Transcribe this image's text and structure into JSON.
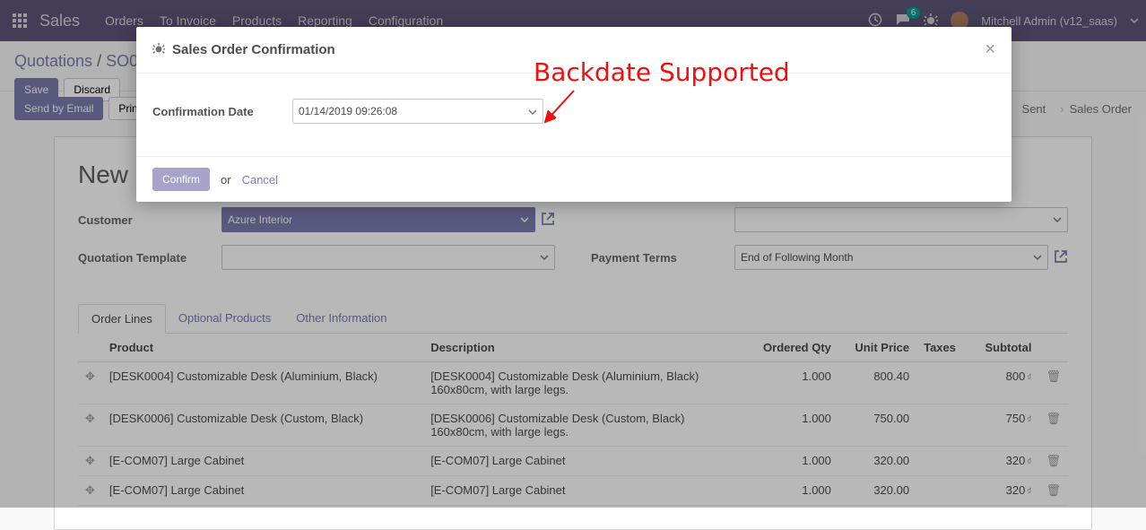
{
  "nav": {
    "brand": "Sales",
    "menu": [
      "Orders",
      "To Invoice",
      "Products",
      "Reporting",
      "Configuration"
    ],
    "chat_count": "6",
    "user": "Mitchell Admin (v12_saas)"
  },
  "breadcrumb": {
    "root": "Quotations",
    "sep": "/",
    "current": "SO0"
  },
  "buttons": {
    "save": "Save",
    "discard": "Discard",
    "send_email": "Send by Email",
    "print": "Prin"
  },
  "statusbar": {
    "stage_sent": "Sent",
    "stage_so": "Sales Order"
  },
  "record": {
    "title": "New"
  },
  "form": {
    "customer_label": "Customer",
    "customer_value": "Azure Interior",
    "quotation_tmpl_label": "Quotation Template",
    "payment_terms_label": "Payment Terms",
    "payment_terms_value": "End of Following Month"
  },
  "tabs": {
    "t1": "Order Lines",
    "t2": "Optional Products",
    "t3": "Other Information"
  },
  "table": {
    "h_product": "Product",
    "h_desc": "Description",
    "h_qty": "Ordered Qty",
    "h_price": "Unit Price",
    "h_taxes": "Taxes",
    "h_subtotal": "Subtotal",
    "rows": [
      {
        "product": "[DESK0004] Customizable Desk (Aluminium, Black)",
        "desc": "[DESK0004] Customizable Desk (Aluminium, Black)\n160x80cm, with large legs.",
        "qty": "1.000",
        "price": "800.40",
        "subtotal": "800",
        "currency": "₫"
      },
      {
        "product": "[DESK0006] Customizable Desk (Custom, Black)",
        "desc": "[DESK0006] Customizable Desk (Custom, Black)\n160x80cm, with large legs.",
        "qty": "1.000",
        "price": "750.00",
        "subtotal": "750",
        "currency": "₫"
      },
      {
        "product": "[E-COM07] Large Cabinet",
        "desc": "[E-COM07] Large Cabinet",
        "qty": "1.000",
        "price": "320.00",
        "subtotal": "320",
        "currency": "₫"
      },
      {
        "product": "[E-COM07] Large Cabinet",
        "desc": "[E-COM07] Large Cabinet",
        "qty": "1.000",
        "price": "320.00",
        "subtotal": "320",
        "currency": "₫"
      }
    ]
  },
  "modal": {
    "title": "Sales Order Confirmation",
    "field_label": "Confirmation Date",
    "field_value": "01/14/2019 09:26:08",
    "confirm": "Confirm",
    "or": "or",
    "cancel": "Cancel"
  },
  "annotation": {
    "text": "Backdate Supported"
  }
}
